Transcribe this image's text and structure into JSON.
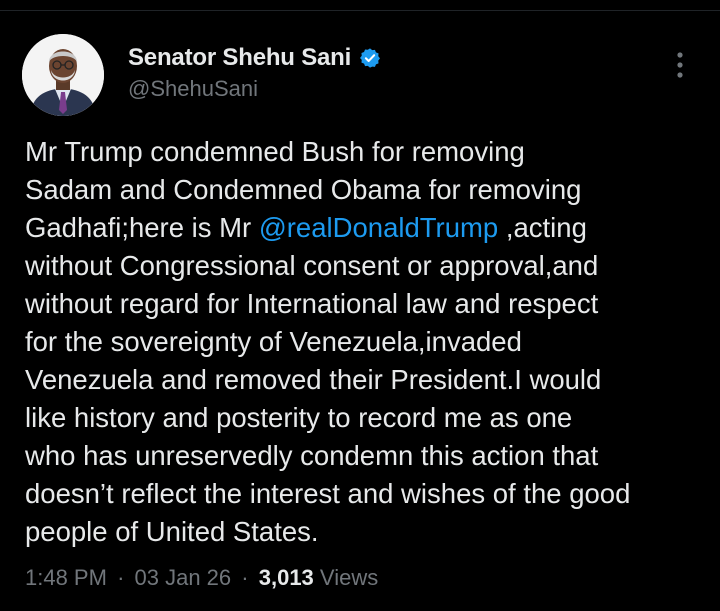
{
  "tweet": {
    "author": {
      "display_name": "Senator Shehu Sani",
      "handle": "@ShehuSani",
      "verified": true,
      "avatar_icon": "profile-photo"
    },
    "text_lines": [
      [
        "Mr Trump condemned Bush for removing"
      ],
      [
        "Sadam and Condemned Obama for removing"
      ],
      [
        "Gadhafi;here is Mr ",
        "@realDonaldTrump",
        " ,acting"
      ],
      [
        "without Congressional consent or approval,and"
      ],
      [
        "without regard for International law and respect"
      ],
      [
        "for the sovereignty of Venezuela,invaded"
      ],
      [
        "Venezuela and removed their President.I would"
      ],
      [
        "like history and posterity to record me as one"
      ],
      [
        "who has unreservedly condemn this action that"
      ],
      [
        "doesn’t reflect the interest and wishes of the good"
      ],
      [
        "people of United States."
      ]
    ],
    "mention": "@realDonaldTrump",
    "meta": {
      "time": "1:48 PM",
      "date": "03 Jan 26",
      "views_count": "3,013",
      "views_label": "Views",
      "separator": "·"
    },
    "more_icon": "more-vertical-icon"
  },
  "colors": {
    "background": "#000000",
    "text": "#e7e9ea",
    "secondary_text": "#71767b",
    "link": "#1d9bf0",
    "verified": "#1d9bf0"
  }
}
